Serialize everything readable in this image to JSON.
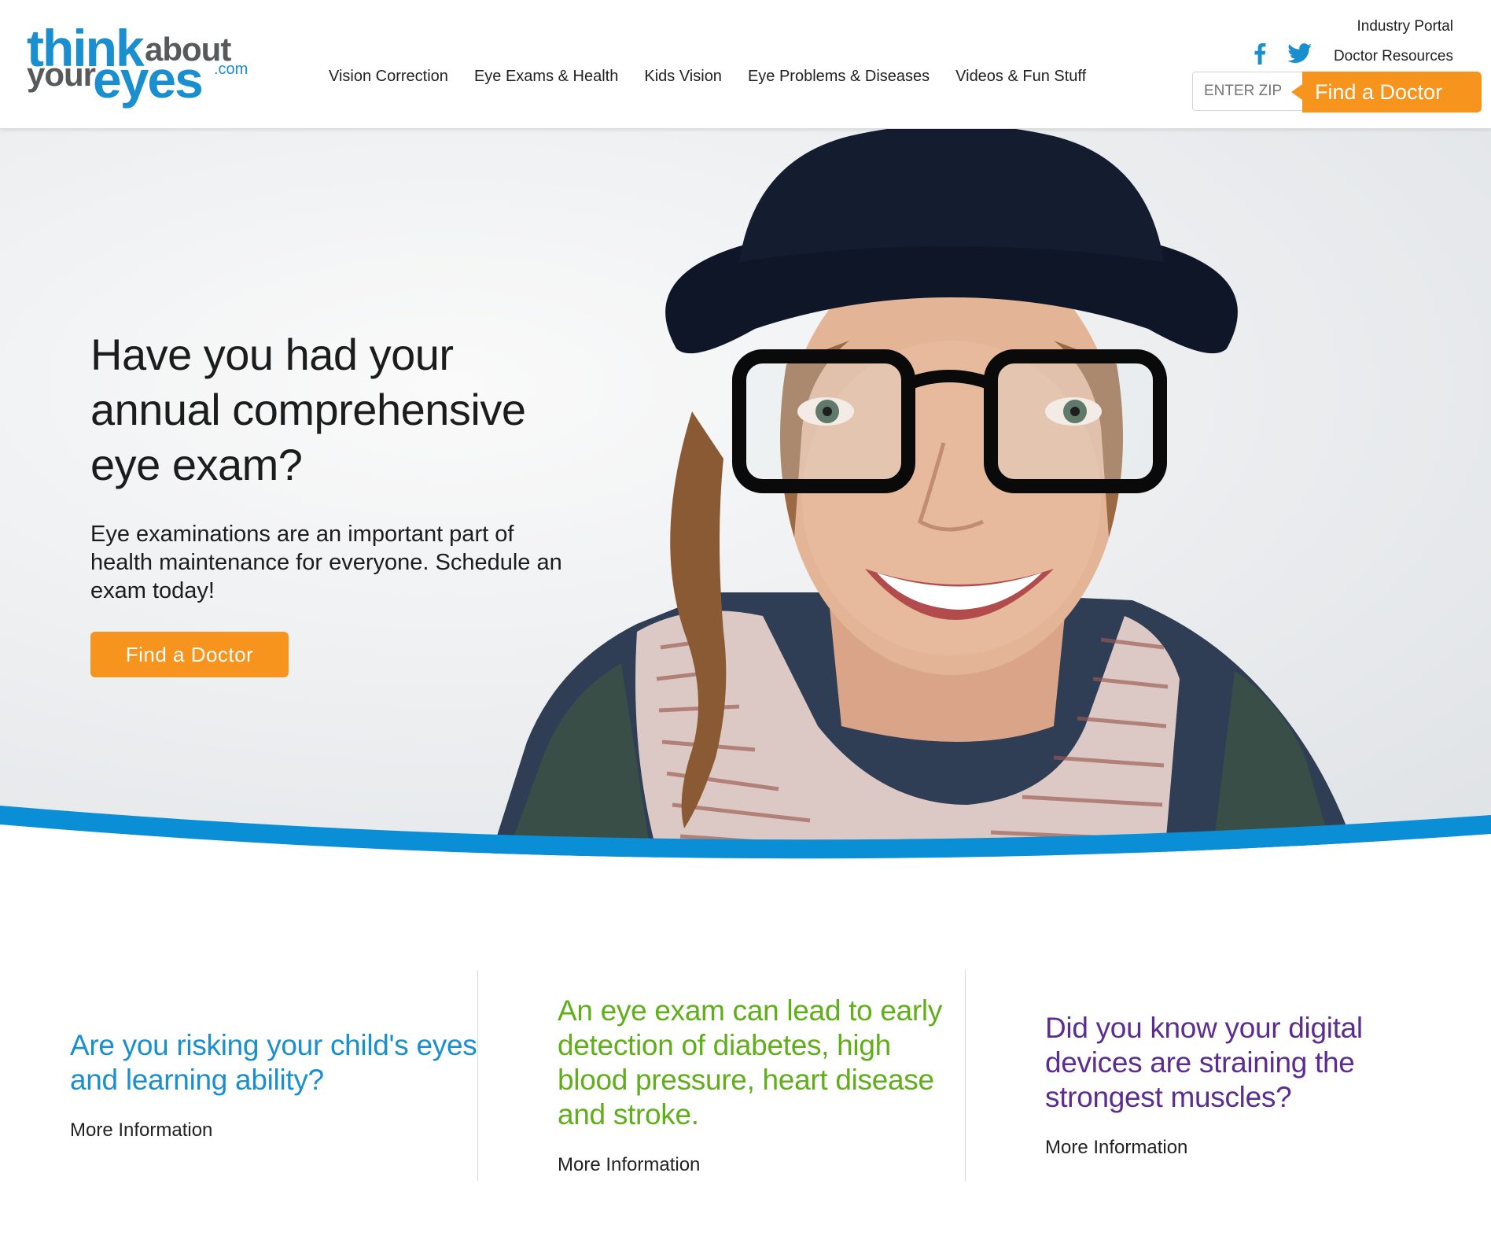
{
  "logo": {
    "think": "think",
    "about": "about",
    "your": "your",
    "eyes": "eyes",
    "com": ".com"
  },
  "nav": {
    "items": [
      {
        "label": "Vision Correction"
      },
      {
        "label": "Eye Exams & Health"
      },
      {
        "label": "Kids Vision"
      },
      {
        "label": "Eye Problems & Diseases"
      },
      {
        "label": "Videos & Fun Stuff"
      }
    ]
  },
  "utility": {
    "industry_portal": "Industry Portal",
    "doctor_resources": "Doctor Resources",
    "social_icons": [
      "facebook-icon",
      "twitter-icon"
    ]
  },
  "zip_search": {
    "placeholder": "ENTER ZIP",
    "button_label": "Find a Doctor"
  },
  "hero": {
    "title": "Have you had your annual comprehensive eye exam?",
    "text": "Eye examinations are an important part of health maintenance for everyone. Schedule an exam today!",
    "button_label": "Find a Doctor"
  },
  "features": [
    {
      "headline": "Are you risking your child's eyes and learning ability?",
      "link": "More Information"
    },
    {
      "headline": "An eye exam can lead to early detection of diabetes, high blood pressure, heart disease and stroke.",
      "link": "More Information"
    },
    {
      "headline": "Did you know your digital devices are straining the strongest muscles?",
      "link": "More Information"
    }
  ],
  "colors": {
    "brand_blue": "#1a8fd0",
    "logo_gray": "#58595b",
    "accent_orange": "#f7941d",
    "green": "#5fae1a",
    "purple": "#5c2d91",
    "swoosh_blue": "#0a8ed6"
  }
}
